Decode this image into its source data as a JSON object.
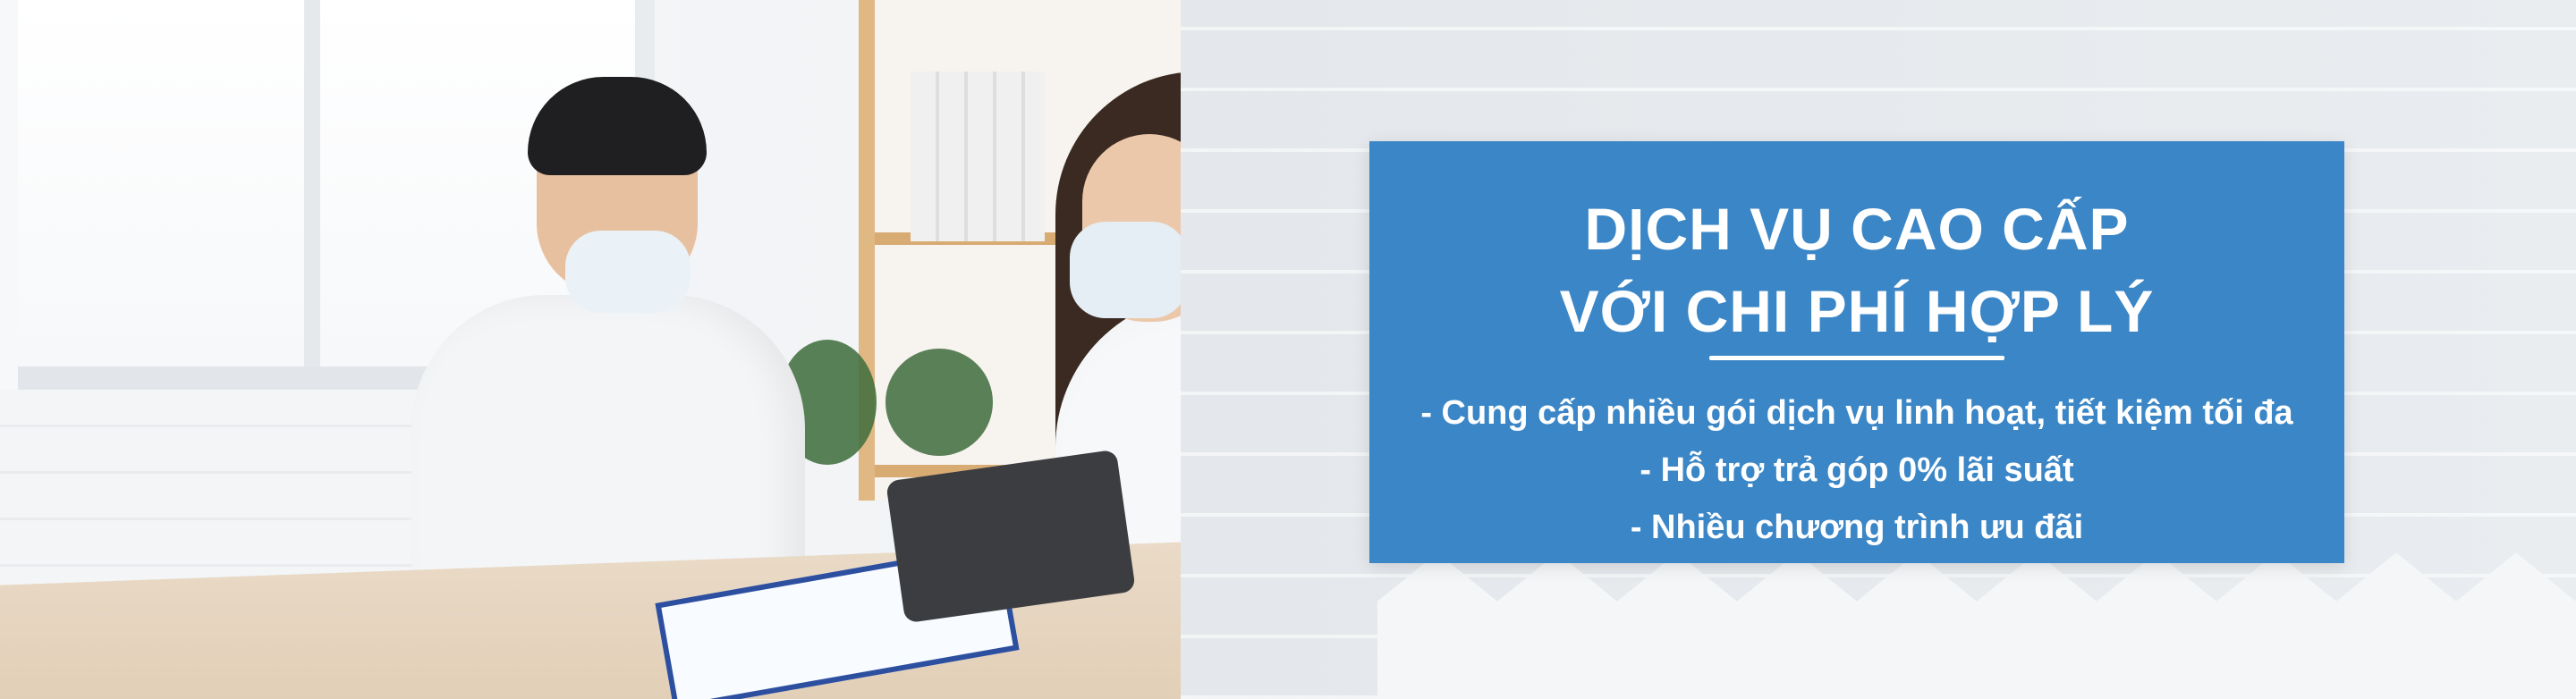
{
  "banner": {
    "headline_line1": "DỊCH VỤ CAO CẤP",
    "headline_line2": "VỚI CHI PHÍ HỢP LÝ",
    "benefits": [
      "- Cung cấp nhiều gói dịch vụ linh hoạt, tiết kiệm tối đa",
      "- Hỗ trợ trả góp 0% lãi suất",
      "- Nhiều chương trình ưu đãi"
    ],
    "accent_color": "#3b86c6",
    "text_color": "#ffffff"
  },
  "photo": {
    "description_icon": "doctor-consultation-photo"
  }
}
